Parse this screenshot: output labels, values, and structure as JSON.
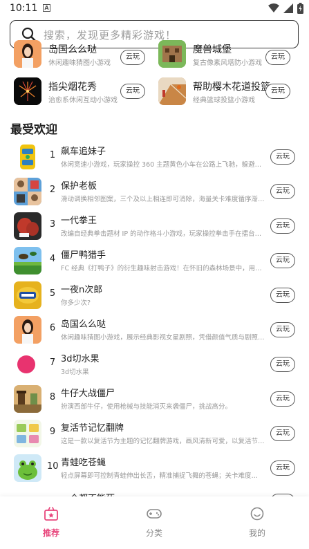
{
  "status": {
    "time": "10:11",
    "badge": "A"
  },
  "search": {
    "placeholder": "搜索，发现更多精彩游戏！"
  },
  "grid": [
    {
      "title": "岛国么么哒",
      "subtitle": "休闲趣味猜图小游戏",
      "button": "云玩",
      "icon": "girl-portrait-icon"
    },
    {
      "title": "魔兽城堡",
      "subtitle": "复古像素风塔防小游戏",
      "button": "云玩",
      "icon": "castle-game-icon"
    },
    {
      "title": "指尖烟花秀",
      "subtitle": "治愈系休闲互动小游戏",
      "button": "云玩",
      "icon": "fireworks-icon"
    },
    {
      "title": "帮助樱木花道投篮",
      "subtitle": "经典篮球投篮小游戏",
      "button": "云玩",
      "icon": "basketball-court-icon"
    }
  ],
  "section_title": "最受欢迎",
  "popular": [
    {
      "rank": "1",
      "title": "飙车追妹子",
      "desc": "休闲竞速小游戏，玩家操控 360 主题黄色小车在公路上飞驰，躲避…",
      "button": "云玩",
      "icon": "yellow-car-icon"
    },
    {
      "rank": "2",
      "title": "保护老板",
      "desc": "滑动调换相邻图案，三个及以上相连即可消除，海量关卡难度循序渐…",
      "button": "云玩",
      "icon": "boss-match-icon"
    },
    {
      "rank": "3",
      "title": "一代拳王",
      "desc": "改编自经典拳击题材 IP 的动作格斗小游戏，玩家操控拳击手在擂台…",
      "button": "云玩",
      "icon": "boxing-glove-icon"
    },
    {
      "rank": "4",
      "title": "僵尸鸭猎手",
      "desc": "FC 经典《打鸭子》的衍生趣味射击游戏！在怀旧的森林场景中，用…",
      "button": "云玩",
      "icon": "duck-hunt-icon"
    },
    {
      "rank": "5",
      "title": "一夜n次郎",
      "desc": "你多少次?",
      "button": "云玩",
      "icon": "condom-box-icon"
    },
    {
      "rank": "6",
      "title": "岛国么么哒",
      "desc": "休闲趣味猜图小游戏，展示经典影视女星剧照，凭借颜值气质与剧照…",
      "button": "云玩",
      "icon": "girl-portrait-icon"
    },
    {
      "rank": "7",
      "title": "3d切水果",
      "desc": "3d切水果",
      "button": "云玩",
      "icon": "pink-ball-icon"
    },
    {
      "rank": "8",
      "title": "牛仔大战僵尸",
      "desc": "扮演西部牛仔，使用枪械与技能消灭来袭僵尸，挑战高分。",
      "button": "云玩",
      "icon": "cowboy-zombie-icon"
    },
    {
      "rank": "9",
      "title": "复活节记忆翻牌",
      "desc": "这是一款以复活节为主题的记忆翻牌游戏，画风清新可爱，以复活节…",
      "button": "云玩",
      "icon": "memory-card-icon"
    },
    {
      "rank": "10",
      "title": "青蛙吃苍蝇",
      "desc": "轻点屏幕即可控制青蛙伸出长舌，精准捕捉飞舞的苍蝇；关卡难度…",
      "button": "云玩",
      "icon": "frog-icon"
    },
    {
      "rank": "",
      "title": "一个都不能死",
      "desc": "",
      "button": "云玩",
      "icon": "game-icon"
    }
  ],
  "nav": [
    {
      "label": "推荐",
      "icon": "recommend-icon",
      "active": true
    },
    {
      "label": "分类",
      "icon": "gamepad-icon",
      "active": false
    },
    {
      "label": "我的",
      "icon": "smile-user-icon",
      "active": false
    }
  ],
  "colors": {
    "accent": "#e8467c",
    "text": "#222222",
    "muted": "#999999"
  }
}
